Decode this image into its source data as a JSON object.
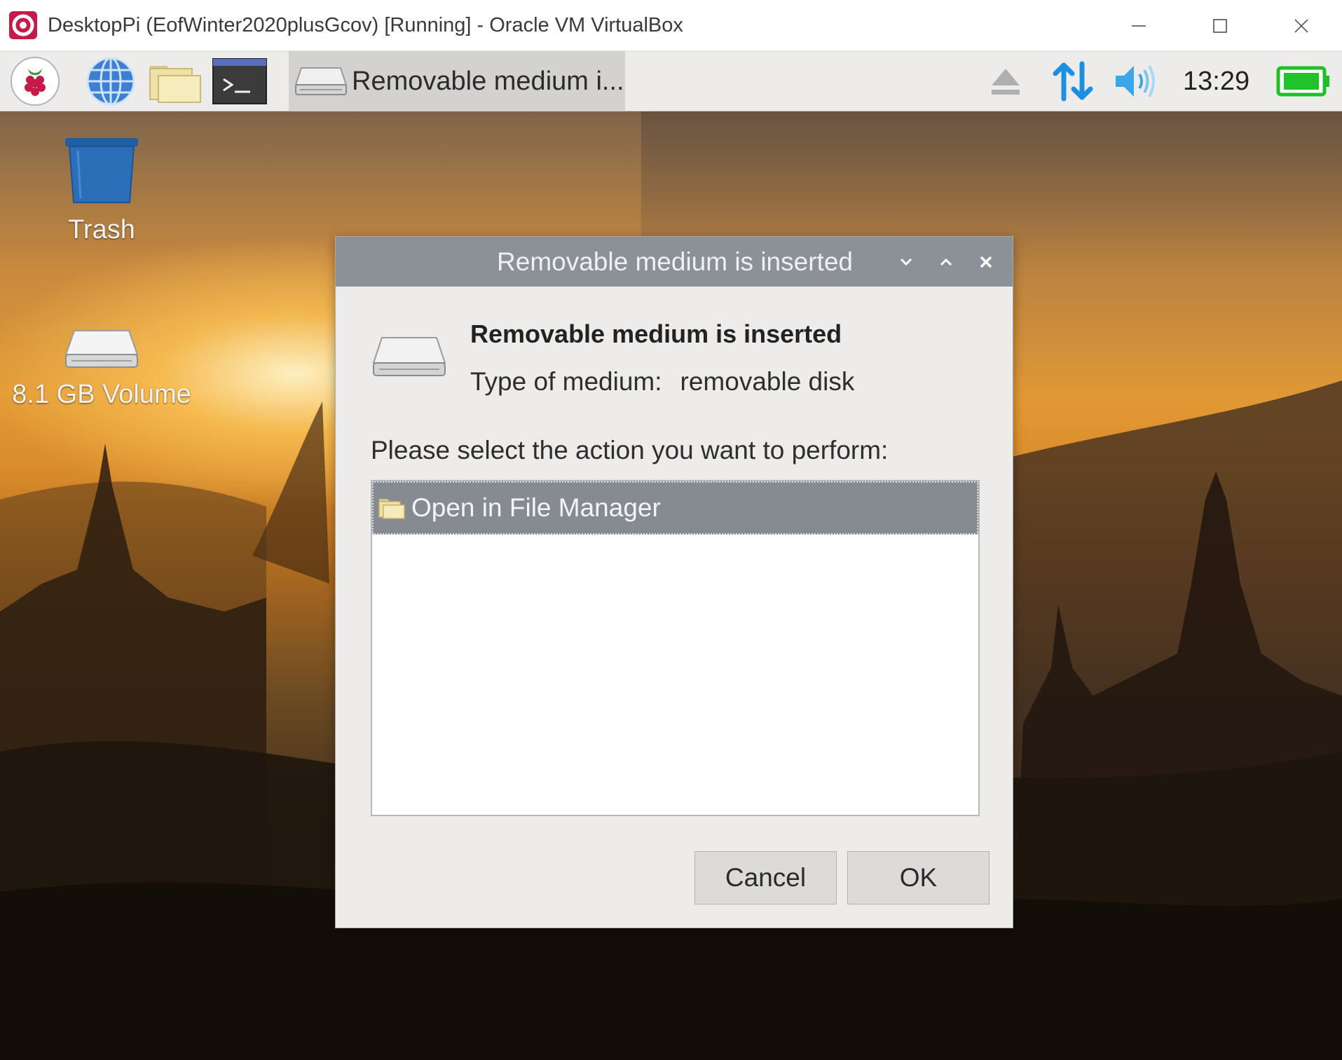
{
  "window": {
    "title": "DesktopPi (EofWinter2020plusGcov) [Running] - Oracle VM VirtualBox",
    "icons": [
      "virtualbox-app-icon",
      "minimize-icon",
      "maximize-icon",
      "close-icon"
    ]
  },
  "panel": {
    "launchers": [
      "raspberry-menu-icon",
      "web-browser-icon",
      "file-manager-icon",
      "terminal-icon"
    ],
    "task_label": "Removable medium i...",
    "tray_icons": [
      "eject-icon",
      "network-icon",
      "volume-icon",
      "battery-icon"
    ],
    "clock": "13:29"
  },
  "desktop": {
    "icons": [
      {
        "label": "Trash",
        "icon": "trash-icon"
      },
      {
        "label": "8.1 GB Volume",
        "icon": "drive-icon"
      }
    ]
  },
  "dialog": {
    "title": "Removable medium is inserted",
    "heading": "Removable medium is inserted",
    "type_label": "Type of medium:",
    "type_value": "removable disk",
    "prompt": "Please select the action you want to perform:",
    "actions": [
      {
        "label": "Open in File Manager",
        "icon": "folder-icon",
        "selected": true
      }
    ],
    "cancel_label": "Cancel",
    "ok_label": "OK"
  },
  "colors": {
    "dialog_titlebar": "#8b9197",
    "selection": "#858b91",
    "panel": "#edeceb",
    "trash_blue": "#2a6fb8",
    "battery_green": "#22c22a",
    "network_blue": "#1d8fe0"
  }
}
